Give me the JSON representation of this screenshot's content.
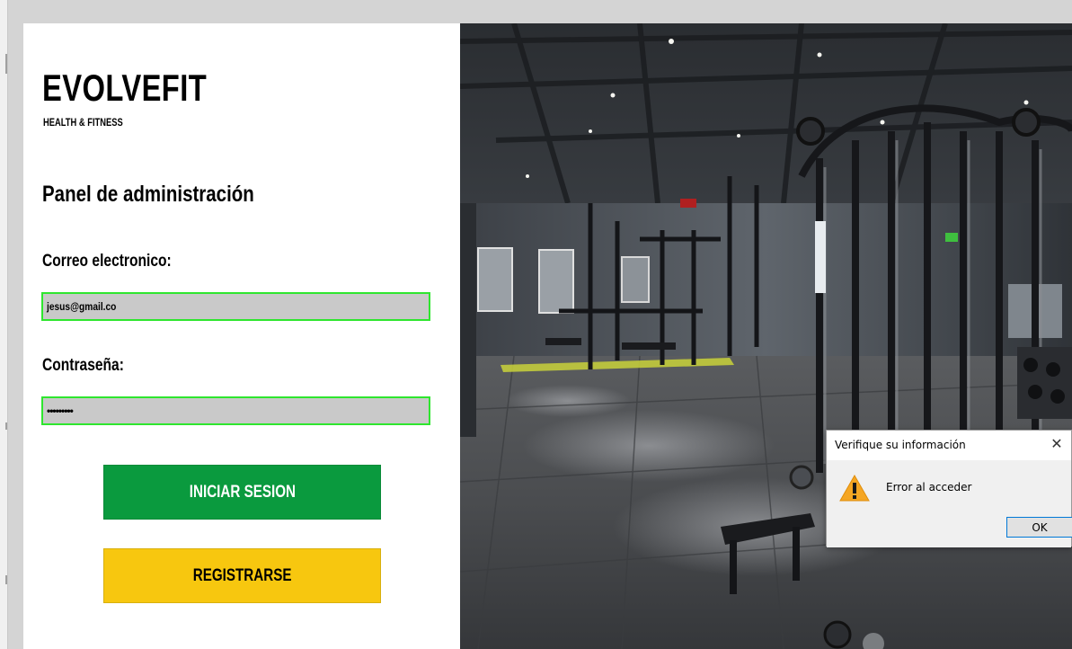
{
  "app": {
    "logo_title": "EVOLVEFIT",
    "logo_subtitle": "HEALTH & FITNESS",
    "panel_title": "Panel de administración"
  },
  "form": {
    "email_label": "Correo electronico:",
    "email_value": "jesus@gmail.co",
    "password_label": "Contraseña:",
    "password_value": "•••••••••",
    "login_button": "INICIAR SESION",
    "register_button": "REGISTRARSE"
  },
  "dialog": {
    "title": "Verifique su información",
    "message": "Error al acceder",
    "ok_button": "OK",
    "close_symbol": "✕",
    "icon": "warning-icon"
  },
  "colors": {
    "login_green": "#0a9a3e",
    "register_yellow": "#f7c70f",
    "field_border": "#2ee62e",
    "field_bg": "#c9c9c9"
  }
}
